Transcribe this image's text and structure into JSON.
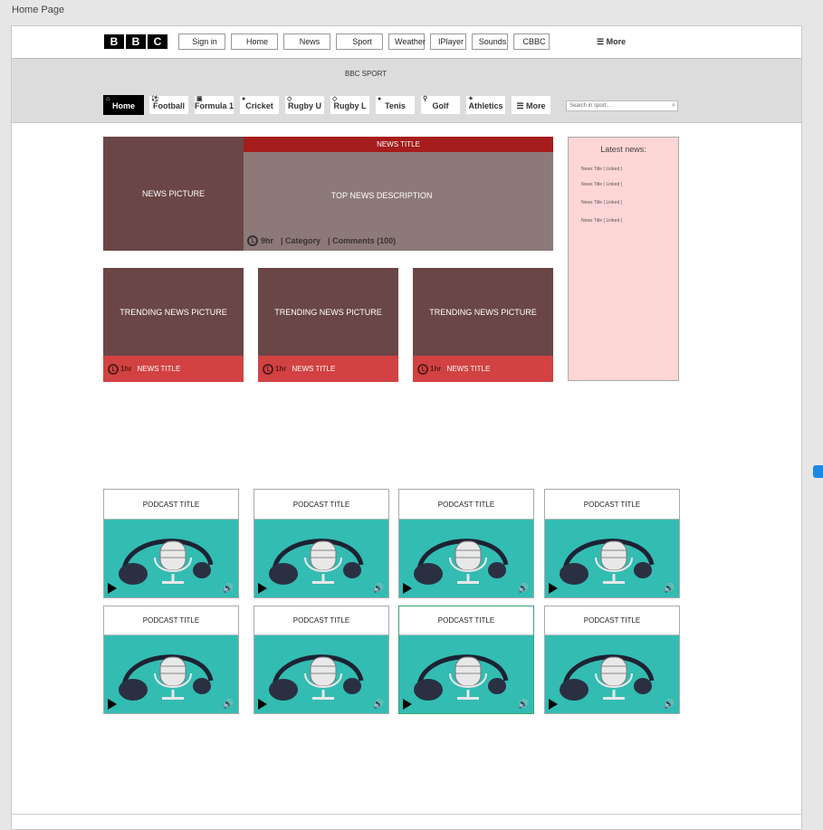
{
  "page_label": "Home Page",
  "logo": [
    "B",
    "B",
    "C"
  ],
  "top_nav": [
    "Sign in",
    "Home",
    "News",
    "Sport",
    "Weather",
    "IPlayer",
    "Sounds",
    "CBBC"
  ],
  "top_more": "☰ More",
  "sport_header": "BBC SPORT",
  "sport_nav": [
    {
      "label": "Home",
      "icon": "home-icon"
    },
    {
      "label": "Football",
      "icon": "football-icon"
    },
    {
      "label": "Formula 1",
      "icon": "car-icon"
    },
    {
      "label": "Cricket",
      "icon": "cricket-ball-icon"
    },
    {
      "label": "Rugby U",
      "icon": "rugby-ball-icon"
    },
    {
      "label": "Rugby L",
      "icon": "rugby-ball-icon"
    },
    {
      "label": "Tenis",
      "icon": "tennis-ball-icon"
    },
    {
      "label": "Golf",
      "icon": "golf-flag-icon"
    },
    {
      "label": "Athletics",
      "icon": "runner-icon"
    },
    {
      "label": "☰ More",
      "icon": ""
    }
  ],
  "search_placeholder": "Search in sport...",
  "hero": {
    "picture": "NEWS PICTURE",
    "title": "NEWS TITLE",
    "description": "TOP NEWS DESCRIPTION",
    "time": "9hr",
    "category": "| Category",
    "comments": "| Comments (100)"
  },
  "latest": {
    "heading": "Latest news:",
    "items": [
      "News Title ( Linked )",
      "News Title ( Linked )",
      "News Title ( Linked )",
      "News Title ( Linked )"
    ]
  },
  "trending": [
    {
      "picture": "TRENDING NEWS PICTURE",
      "time": "1hr",
      "title": "NEWS TITLE"
    },
    {
      "picture": "TRENDING NEWS PICTURE",
      "time": "1hr",
      "title": "NEWS TITLE"
    },
    {
      "picture": "TRENDING NEWS PICTURE",
      "time": "1hr",
      "title": "NEWS TITLE"
    }
  ],
  "podcasts": [
    "PODCAST TITLE",
    "PODCAST TITLE",
    "PODCAST TITLE",
    "PODCAST TITLE",
    "PODCAST TITLE",
    "PODCAST TITLE",
    "PODCAST TITLE",
    "PODCAST TITLE"
  ],
  "colors": {
    "brand_red": "#a51c1c",
    "trend_red": "#d24242",
    "picture_brown": "#6b4646",
    "podcast_teal": "#33bcb2",
    "sidebar_pink": "#ffd6d6"
  }
}
